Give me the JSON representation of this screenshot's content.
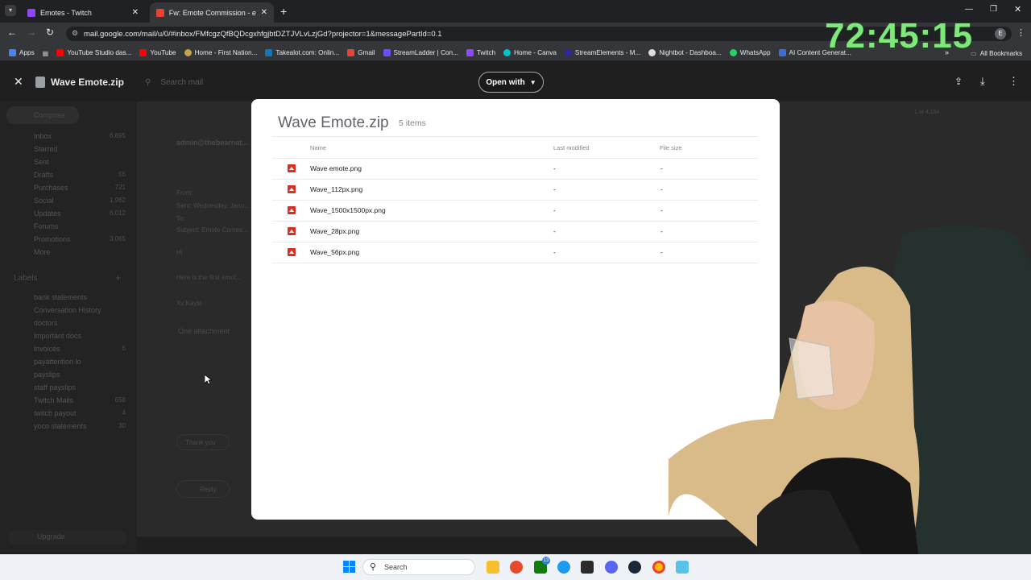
{
  "browser": {
    "tabs": [
      {
        "title": "Emotes - Twitch",
        "active": false
      },
      {
        "title": "Fw: Emote Commission - erned",
        "active": true
      }
    ],
    "url": "mail.google.com/mail/u/0/#inbox/FMfcgzQfBQDcgxhfgjbtDZTJVLvLzjGd?projector=1&messagePartId=0.1",
    "bookmarks": [
      "Apps",
      "YouTube Studio das...",
      "YouTube",
      "Home - First Nation...",
      "Takealot.com: Onlin...",
      "Gmail",
      "StreamLadder | Con...",
      "Twitch",
      "Home - Canva",
      "StreamElements - M...",
      "Nightbot - Dashboa...",
      "WhatsApp",
      "AI Content Generat..."
    ],
    "all_bookmarks": "All Bookmarks",
    "profile_letter": "E"
  },
  "viewer": {
    "file_title": "Wave Emote.zip",
    "open_with": "Open with",
    "search_placeholder": "Search mail"
  },
  "gmail_bg": {
    "compose": "Compose",
    "nav": [
      {
        "label": "Inbox",
        "count": "6,895"
      },
      {
        "label": "Starred",
        "count": ""
      },
      {
        "label": "Sent",
        "count": ""
      },
      {
        "label": "Drafts",
        "count": "56"
      },
      {
        "label": "Purchases",
        "count": "721"
      },
      {
        "label": "Social",
        "count": "1,962"
      },
      {
        "label": "Updates",
        "count": "6,012"
      },
      {
        "label": "Forums",
        "count": ""
      },
      {
        "label": "Promotions",
        "count": "3,065"
      },
      {
        "label": "More",
        "count": ""
      }
    ],
    "labels_header": "Labels",
    "labels": [
      {
        "label": "bank statements",
        "count": ""
      },
      {
        "label": "Conversation History",
        "count": ""
      },
      {
        "label": "doctors",
        "count": ""
      },
      {
        "label": "important docs",
        "count": ""
      },
      {
        "label": "invoices",
        "count": "6"
      },
      {
        "label": "payattention lo",
        "count": ""
      },
      {
        "label": "payslips",
        "count": ""
      },
      {
        "label": "staff payslips",
        "count": ""
      },
      {
        "label": "Twitch Mails",
        "count": "658"
      },
      {
        "label": "twitch payout",
        "count": "4"
      },
      {
        "label": "yoco statements",
        "count": "30"
      }
    ],
    "upgrade": "Upgrade",
    "sender": "admin@thebearnat...",
    "from_label": "From:",
    "sent_label": "Sent: Wednesday, Janu...",
    "to_label": "To:",
    "subject_label": "Subject: Emote Commi...",
    "greeting": "Hi",
    "body": "Here is the first emot...",
    "signoff": "Xx Kayla",
    "attachment": "One attachment",
    "reply": "Reply",
    "thank_you": "Thank you",
    "pager": "1 of 4,184"
  },
  "zip": {
    "title": "Wave Emote.zip",
    "count": "5 items",
    "columns": {
      "name": "Name",
      "modified": "Last modified",
      "size": "File size"
    },
    "files": [
      {
        "name": "Wave emote.png",
        "modified": "-",
        "size": "-"
      },
      {
        "name": "Wave_112px.png",
        "modified": "-",
        "size": "-"
      },
      {
        "name": "Wave_1500x1500px.png",
        "modified": "-",
        "size": "-"
      },
      {
        "name": "Wave_28px.png",
        "modified": "-",
        "size": "-"
      },
      {
        "name": "Wave_56px.png",
        "modified": "-",
        "size": "-"
      }
    ]
  },
  "overlay": {
    "timer": "72:45:15"
  },
  "taskbar": {
    "search": "Search",
    "badge": "13"
  }
}
